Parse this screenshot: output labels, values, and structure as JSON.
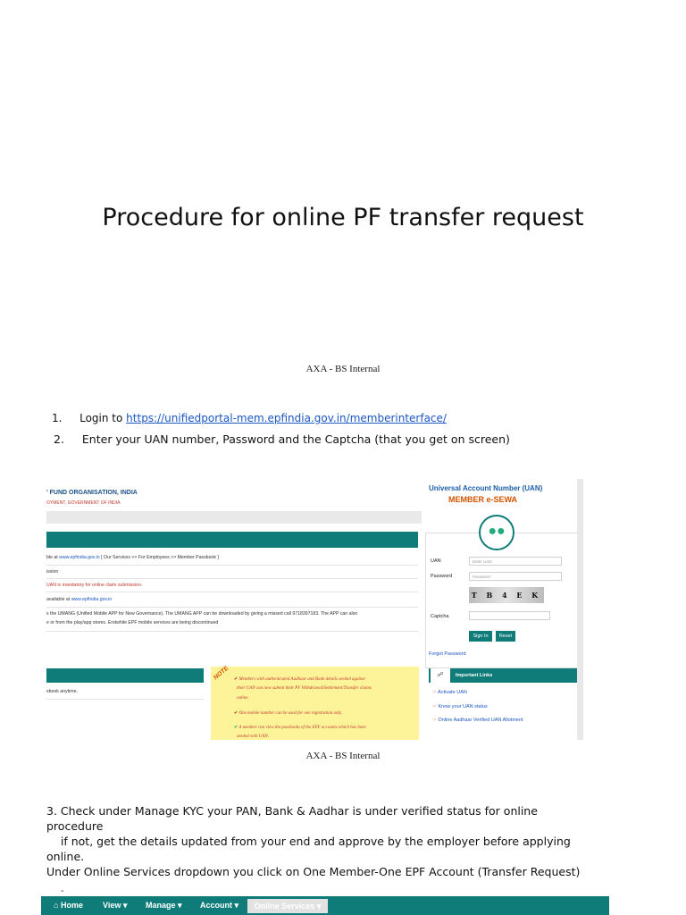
{
  "title": "Procedure for online PF transfer request",
  "footer_label": "AXA - BS Internal",
  "steps": [
    {
      "number": "1.",
      "text": "Login to ",
      "link": "https://unifiedportal-mem.epfindia.gov.in/memberinterface/"
    },
    {
      "number": "2.",
      "text": "Enter your UAN number, Password and the Captcha (that you get on screen)"
    }
  ],
  "screenshot": {
    "org_name": "' FUND ORGANISATION, INDIA",
    "org_sub": "OYMENT, GOVERNMENT OF INDIA",
    "portal_title": "Universal Account Number (UAN)",
    "portal_subtitle": "MEMBER e-SEWA",
    "info_lines": [
      {
        "pre": "ble at ",
        "link": "www.epfindia.gov.in",
        "post": " [ Our Services >> For Employees >> Member Passbook ]"
      },
      {
        "pre": "ission",
        "link": "",
        "post": ""
      },
      {
        "pre": "UAN is mandatory for online claim submission.",
        "link": "",
        "post": ""
      },
      {
        "pre": "available at ",
        "link": "www.epfindia.gov.in",
        "post": ""
      },
      {
        "pre": "s the UMANG (Unified Mobile APP for New Governance). The UMANG APP can be downloaded by giving a missed call 9718397183. The APP can also",
        "link": "",
        "post": ""
      },
      {
        "pre": "e or from the play/app stores. Erstwhile EPF mobile services are being discontinued",
        "link": "",
        "post": ""
      }
    ],
    "passbook_line": "sbook anytime.",
    "note_stamp": "NOTE",
    "note_lines": [
      "Members with authenticated Aadhaar and Bank details seeded against",
      "their UAN can now submit their PF Withdrawal/Settlement/Transfer claims",
      "online.",
      "One mobile number can be used for one registration only.",
      "A member can view the passbooks of the EPF accounts which has been",
      "seeded with UAN."
    ],
    "login": {
      "uan_label": "UAN",
      "uan_placeholder": "Enter UAN",
      "password_label": "Password",
      "password_placeholder": "Password",
      "captcha_text": "T B 4 E K",
      "captcha_label": "Captcha",
      "signin": "Sign In",
      "reset": "Reset",
      "forgot": "Forgot Password"
    },
    "important_links_title": "Important Links",
    "important_links": [
      "Activate UAN",
      "Know your UAN status",
      "Online Aadhaar Verified UAN Allotment"
    ]
  },
  "para3_line1": "3. Check under Manage KYC your PAN, Bank & Aadhar is under verified status for online procedure",
  "para3_line2": "    if not, get the details updated from your end and approve by the employer before applying",
  "para3_line3": "online.",
  "para4": "Under Online Services dropdown you click on One Member-One EPF Account (Transfer Request)",
  "dash": "-",
  "nav": {
    "home": "Home",
    "view": "View",
    "manage": "Manage",
    "account": "Account",
    "online_services": "Online Services"
  },
  "colors": {
    "teal": "#0f7c7a",
    "link": "#1a56c4",
    "note_bg": "#fdf49a"
  }
}
